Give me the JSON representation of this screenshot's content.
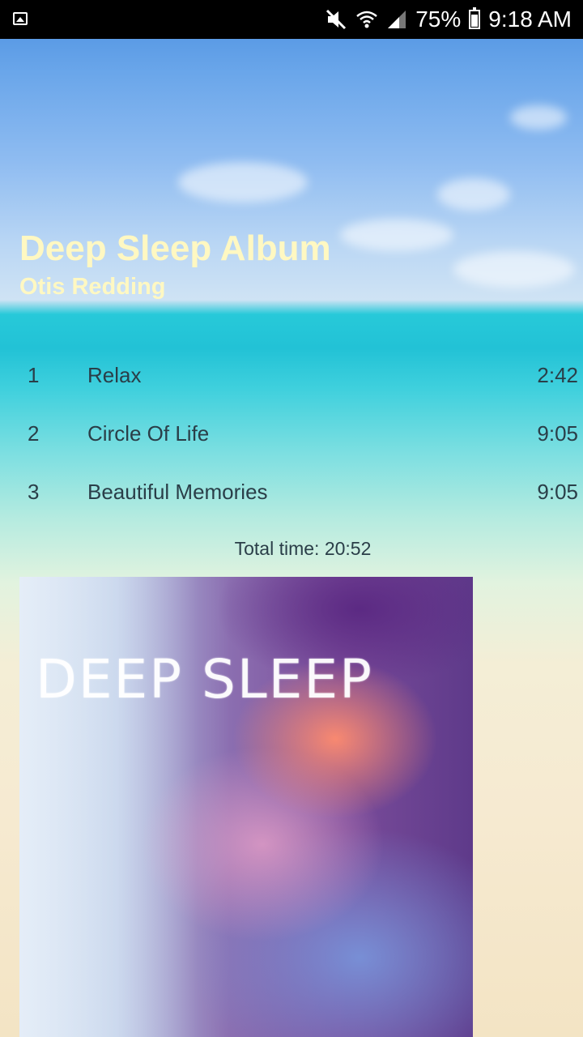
{
  "status_bar": {
    "battery": "75%",
    "time": "9:18 AM"
  },
  "album": {
    "title": "Deep Sleep Album",
    "artist": "Otis Redding"
  },
  "tracks": [
    {
      "number": "1",
      "title": "Relax",
      "duration": "2:42"
    },
    {
      "number": "2",
      "title": "Circle Of Life",
      "duration": "9:05"
    },
    {
      "number": "3",
      "title": "Beautiful Memories",
      "duration": "9:05"
    }
  ],
  "total_time": "Total time: 20:52",
  "cover_art": {
    "text": "DEEP SLEEP"
  },
  "colors": {
    "title": "#fff8c2",
    "track_text": "#2a3e48",
    "status_bar_bg": "#000000"
  }
}
